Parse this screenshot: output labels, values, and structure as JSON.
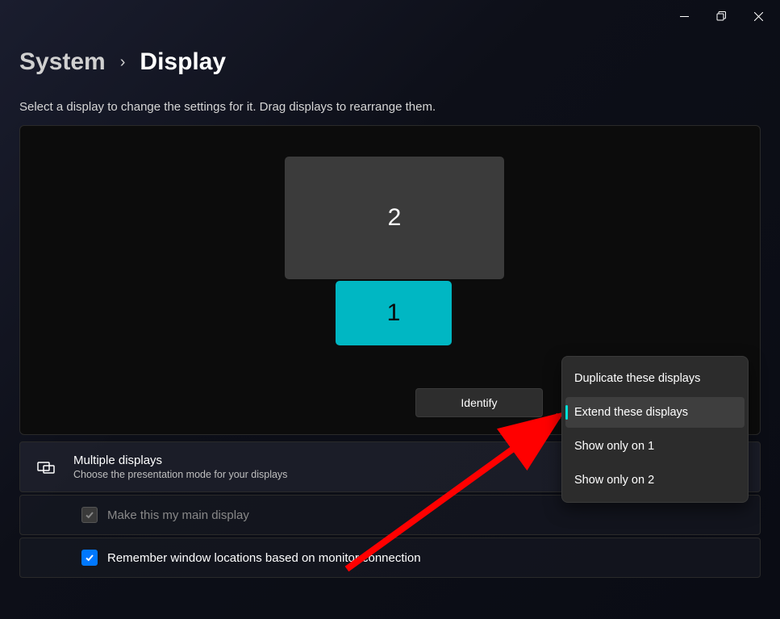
{
  "titlebar": {
    "minimize": "Minimize",
    "maximize": "Restore",
    "close": "Close"
  },
  "breadcrumb": {
    "parent": "System",
    "current": "Display"
  },
  "subtitle": "Select a display to change the settings for it. Drag displays to rearrange them.",
  "monitors": {
    "one": "1",
    "two": "2"
  },
  "identify_button": "Identify",
  "dropdown": {
    "duplicate": "Duplicate these displays",
    "extend": "Extend these displays",
    "only1": "Show only on 1",
    "only2": "Show only on 2"
  },
  "multiple_displays": {
    "title": "Multiple displays",
    "desc": "Choose the presentation mode for your displays"
  },
  "main_display_label": "Make this my main display",
  "remember_label": "Remember window locations based on monitor connection"
}
